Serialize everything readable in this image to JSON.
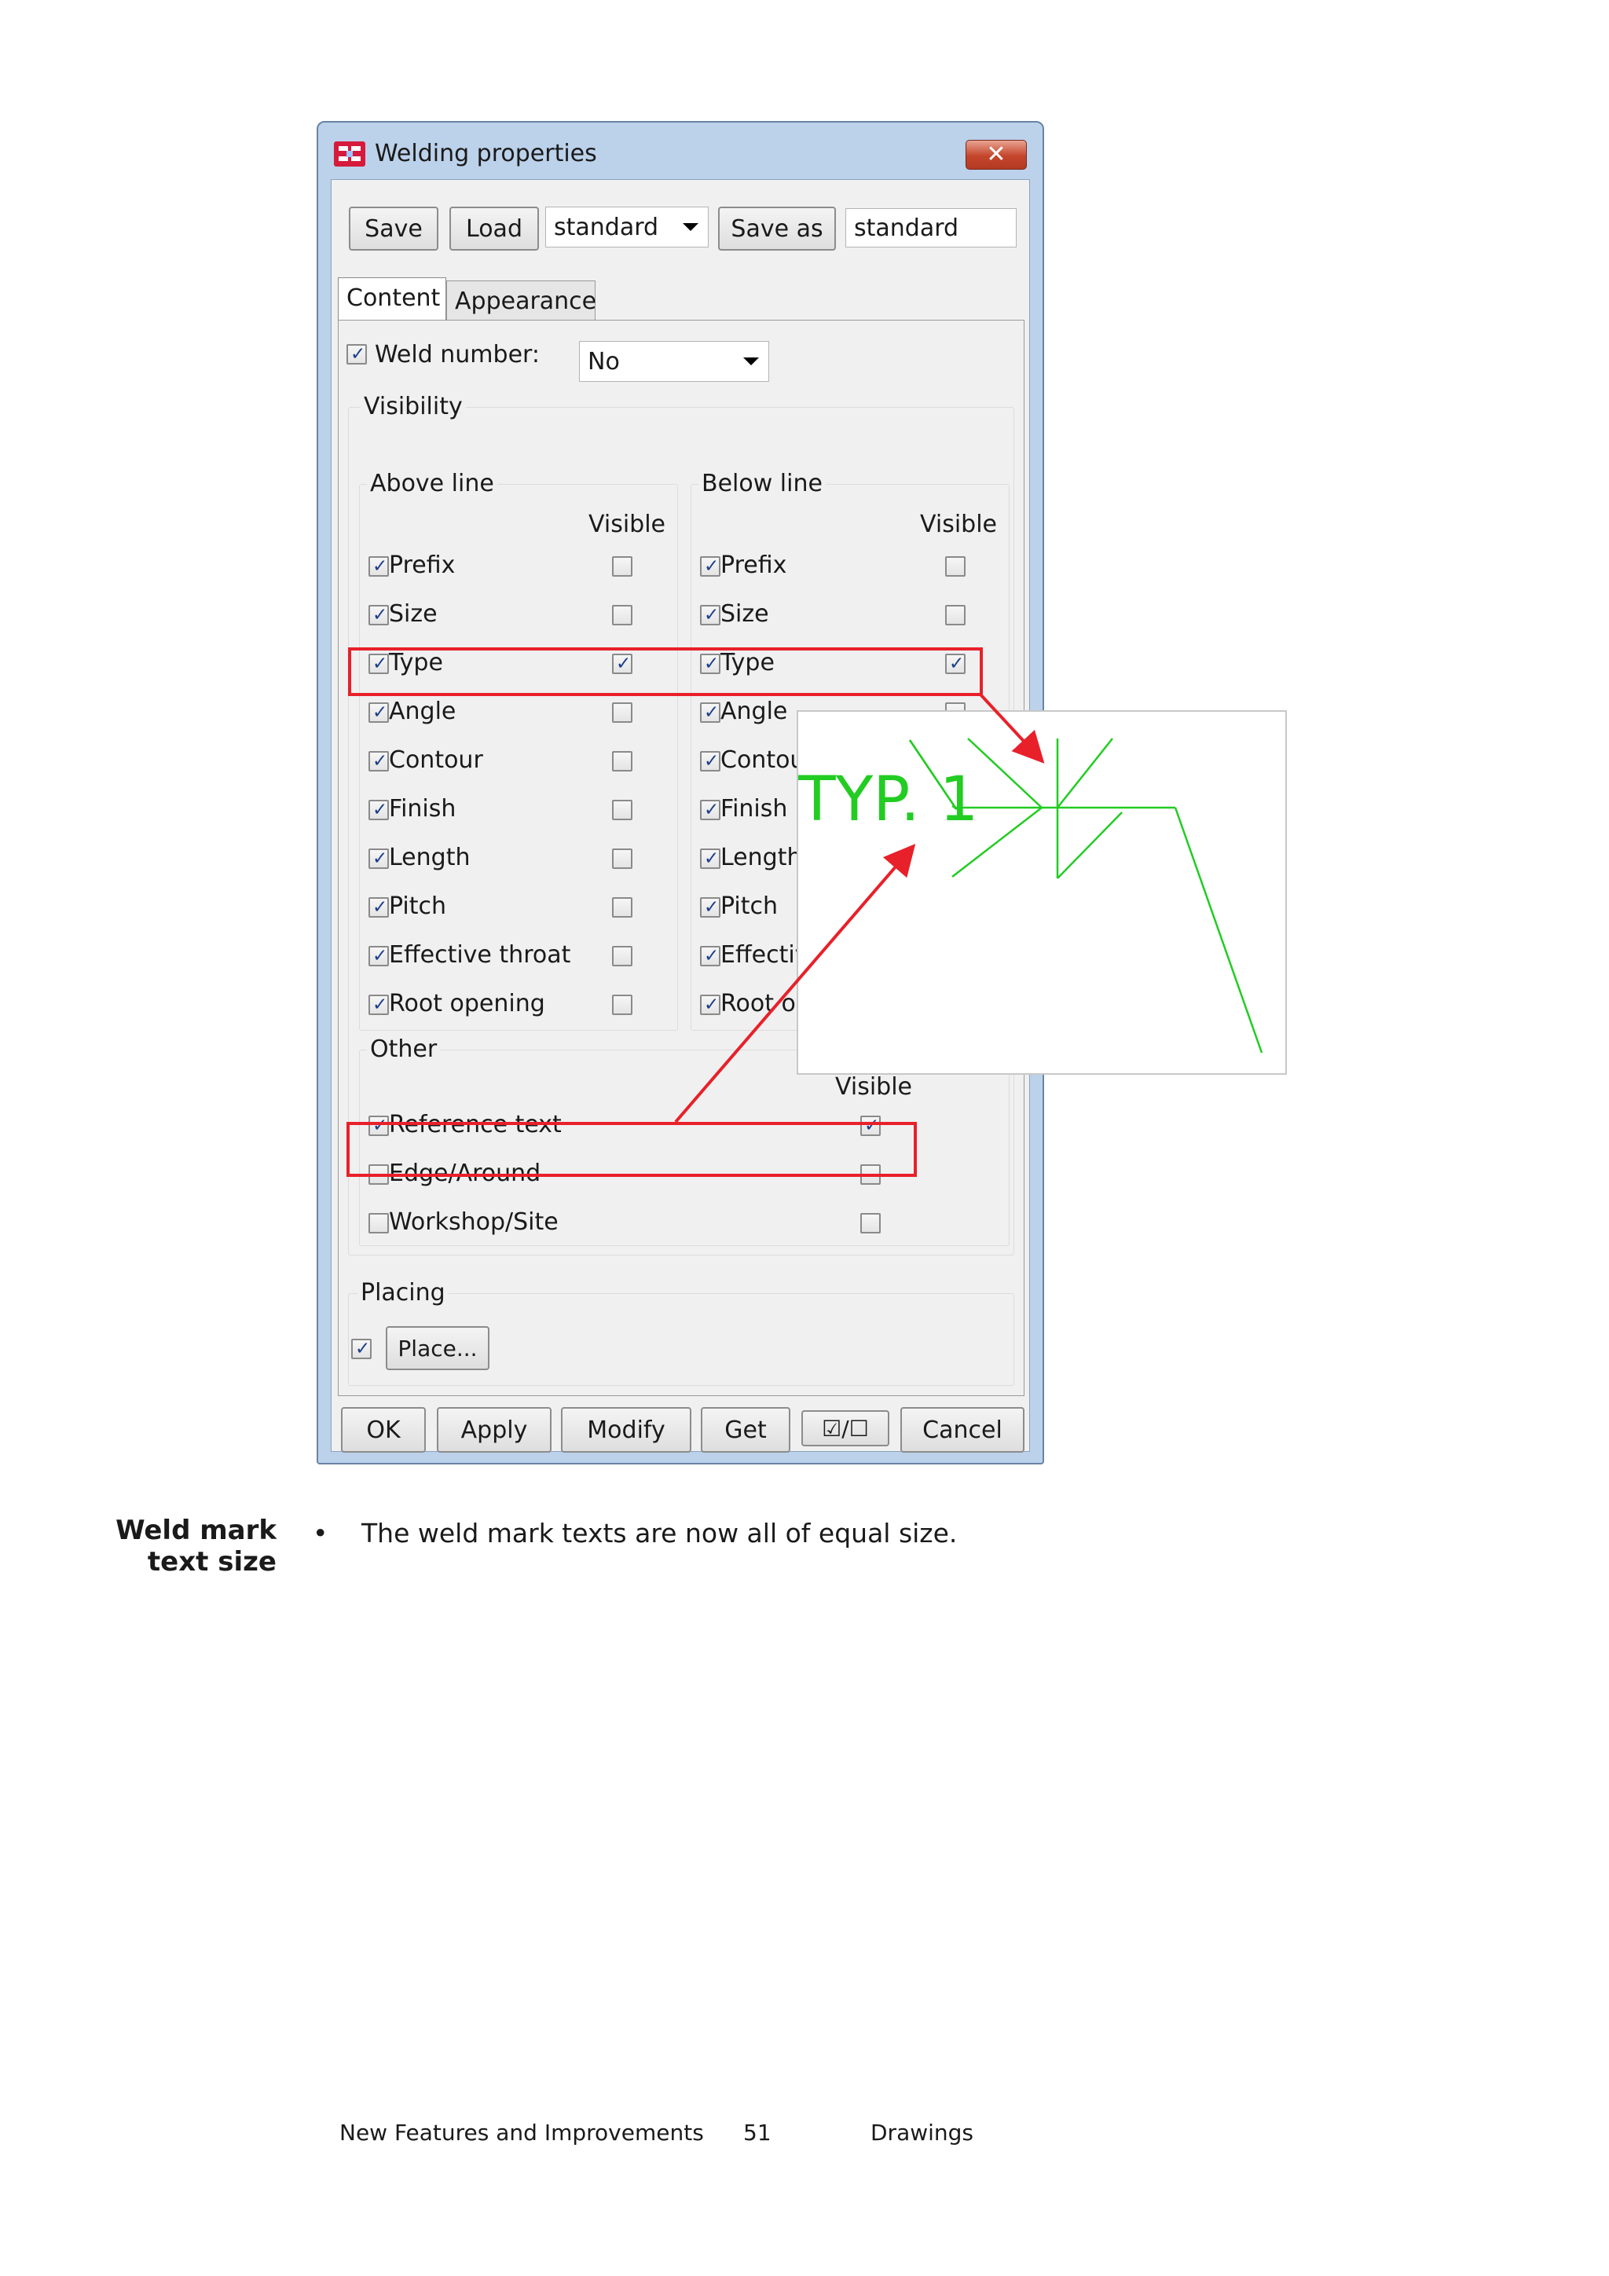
{
  "dialog": {
    "title": "Welding properties",
    "close_glyph": "✕",
    "toolbar": {
      "save_label": "Save",
      "load_label": "Load",
      "load_selected": "standard",
      "save_as_label": "Save as",
      "save_as_value": "standard"
    },
    "tabs": [
      {
        "label": "Content",
        "active": true
      },
      {
        "label": "Appearance",
        "active": false
      }
    ],
    "weld_number": {
      "label": "Weld number:",
      "checked": true,
      "value": "No"
    },
    "visibility_title": "Visibility",
    "above_line": {
      "title": "Above line",
      "visible_header": "Visible",
      "rows": [
        {
          "label": "Prefix",
          "checked": true,
          "visible": false
        },
        {
          "label": "Size",
          "checked": true,
          "visible": false
        },
        {
          "label": "Type",
          "checked": true,
          "visible": true
        },
        {
          "label": "Angle",
          "checked": true,
          "visible": false
        },
        {
          "label": "Contour",
          "checked": true,
          "visible": false
        },
        {
          "label": "Finish",
          "checked": true,
          "visible": false
        },
        {
          "label": "Length",
          "checked": true,
          "visible": false
        },
        {
          "label": "Pitch",
          "checked": true,
          "visible": false
        },
        {
          "label": "Effective throat",
          "checked": true,
          "visible": false
        },
        {
          "label": "Root opening",
          "checked": true,
          "visible": false
        }
      ]
    },
    "below_line": {
      "title": "Below line",
      "visible_header": "Visible",
      "rows": [
        {
          "label": "Prefix",
          "checked": true,
          "visible": false
        },
        {
          "label": "Size",
          "checked": true,
          "visible": false
        },
        {
          "label": "Type",
          "checked": true,
          "visible": true
        },
        {
          "label": "Angle",
          "checked": true,
          "visible": false
        },
        {
          "label": "Contour",
          "checked": true,
          "visible": false
        },
        {
          "label": "Finish",
          "checked": true,
          "visible": false
        },
        {
          "label": "Length",
          "checked": true,
          "visible": false
        },
        {
          "label": "Pitch",
          "checked": true,
          "visible": false
        },
        {
          "label": "Effective throat",
          "checked": true,
          "visible": false
        },
        {
          "label": "Root opening",
          "checked": true,
          "visible": false
        }
      ]
    },
    "other": {
      "title": "Other",
      "visible_header": "Visible",
      "rows": [
        {
          "label": "Reference text",
          "checked": true,
          "visible": true
        },
        {
          "label": "Edge/Around",
          "checked": false,
          "visible": false
        },
        {
          "label": "Workshop/Site",
          "checked": false,
          "visible": false
        }
      ]
    },
    "placing": {
      "title": "Placing",
      "checked": true,
      "button_label": "Place..."
    },
    "footer_buttons": {
      "ok": "OK",
      "apply": "Apply",
      "modify": "Modify",
      "get": "Get",
      "toggle": "☑/☐",
      "cancel": "Cancel"
    }
  },
  "callout": {
    "weld_text": "TYP. 1",
    "line_color": "#22cc22",
    "arrow_color": "#e8202a"
  },
  "section": {
    "heading": "Weld mark text size",
    "bullet": "•",
    "text": "The weld mark texts are now all of equal size."
  },
  "page_footer": {
    "left": "New Features and Improvements",
    "page_number": "51",
    "right": "Drawings"
  }
}
